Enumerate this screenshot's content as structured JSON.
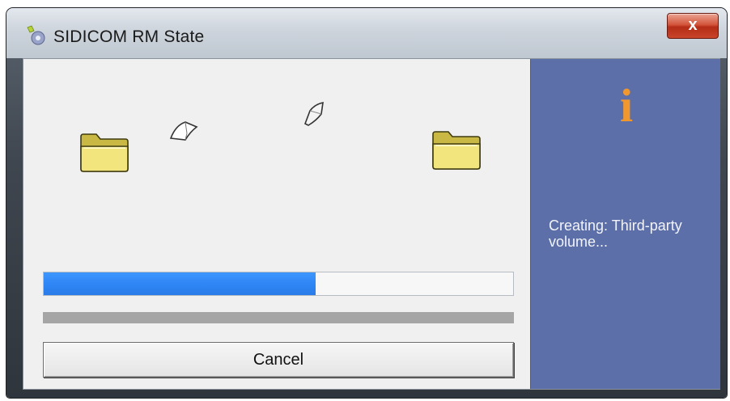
{
  "window": {
    "title": "SIDICOM RM State",
    "close_label": "x"
  },
  "animation": {
    "icons": [
      "source-folder-icon",
      "flying-document-icon",
      "flying-document-icon",
      "target-folder-icon"
    ]
  },
  "progress": {
    "main_fraction": 0.58,
    "secondary_fraction": 1.0
  },
  "buttons": {
    "cancel_label": "Cancel"
  },
  "info_panel": {
    "icon": "info-icon",
    "icon_glyph": "i",
    "status_text": "Creating: Third-party volume..."
  },
  "colors": {
    "progress_fill": "#2f86f5",
    "info_panel_bg": "#5c6fa8",
    "info_icon": "#f0972e",
    "close_button": "#c8442a"
  }
}
